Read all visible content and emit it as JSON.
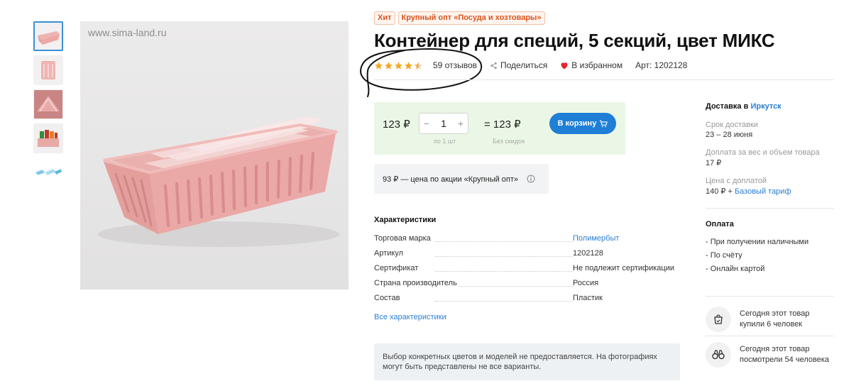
{
  "gallery": {
    "watermark": "www.sima-land.ru",
    "thumbnails": [
      "thumb-1",
      "thumb-2",
      "thumb-3",
      "thumb-4",
      "thumb-5"
    ]
  },
  "badges": [
    "Хит",
    "Крупный опт «Посуда и хозтовары»"
  ],
  "product": {
    "title": "Контейнер для специй, 5 секций, цвет МИКС",
    "rating": 4.5,
    "reviews": "59 отзывов",
    "share": "Поделиться",
    "favorite": "В избранном",
    "article": "Арт: 1202128"
  },
  "buy": {
    "price": "123 ₽",
    "qty": "1",
    "minus": "−",
    "plus": "+",
    "per_unit": "по 1 шт",
    "total": "= 123 ₽",
    "no_discount": "Без скидок",
    "cart_label": "В корзину"
  },
  "promo": {
    "text": "93 ₽ — цена по акции «Крупный опт»"
  },
  "characteristics": {
    "title": "Характеристики",
    "rows": [
      {
        "key": "Торговая марка",
        "value": "Полимербыт"
      },
      {
        "key": "Артикул",
        "value": "1202128"
      },
      {
        "key": "Сертификат",
        "value": "Не подлежит сертификации"
      },
      {
        "key": "Страна производитель",
        "value": "Россия"
      },
      {
        "key": "Состав",
        "value": "Пластик"
      }
    ],
    "all_link": "Все характеристики"
  },
  "notice": "Выбор конкретных цветов и моделей не предоставляется. На фотографиях могут быть представлены не все варианты.",
  "delivery": {
    "title_prefix": "Доставка в",
    "city": "Иркутск",
    "term_label": "Срок доставки",
    "term_value": "23 – 28 июня",
    "extra_label": "Доплата за вес и объем товара",
    "extra_value": "17 ₽",
    "price_label": "Цена с доплатой",
    "price_value": "140 ₽ +",
    "tariff": "Базовый тариф"
  },
  "payment": {
    "title": "Оплата",
    "items": [
      "- При получении наличными",
      "- По счёту",
      "- Онлайн картой"
    ]
  },
  "stats": {
    "bought_line1": "Сегодня этот товар",
    "bought_line2": "купили 6 человек",
    "viewed_line1": "Сегодня этот товар",
    "viewed_line2": "посмотрели 54 человека"
  },
  "colors": {
    "accent_blue": "#1f7fd6",
    "link_blue": "#2a7fd4",
    "star_orange": "#f7a823",
    "buy_panel_bg": "#ebf7e6",
    "badge_orange": "#d9541e",
    "heart_red": "#e3262f"
  }
}
